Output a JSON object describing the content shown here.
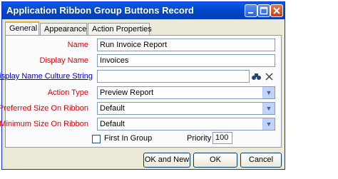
{
  "window": {
    "title": "Application Ribbon Group Buttons  Record"
  },
  "tabs": [
    {
      "label": "General"
    },
    {
      "label": "Appearance"
    },
    {
      "label": "Action Properties"
    }
  ],
  "form": {
    "name": {
      "label": "Name",
      "value": "Run Invoice Report"
    },
    "display_name": {
      "label": "Display Name",
      "value": "Invoices"
    },
    "culture_string": {
      "label": "Display Name Culture String",
      "value": ""
    },
    "action_type": {
      "label": "Action Type",
      "value": "Preview Report"
    },
    "preferred_size": {
      "label": "Preferred Size On Ribbon",
      "value": "Default"
    },
    "minimum_size": {
      "label": "Minimum Size On Ribbon",
      "value": "Default"
    },
    "first_in_group": {
      "label": "First In Group",
      "checked": false
    },
    "priority": {
      "label": "Priority",
      "value": "100"
    }
  },
  "buttons": {
    "ok_new": "OK and New",
    "ok": "OK",
    "cancel": "Cancel"
  }
}
